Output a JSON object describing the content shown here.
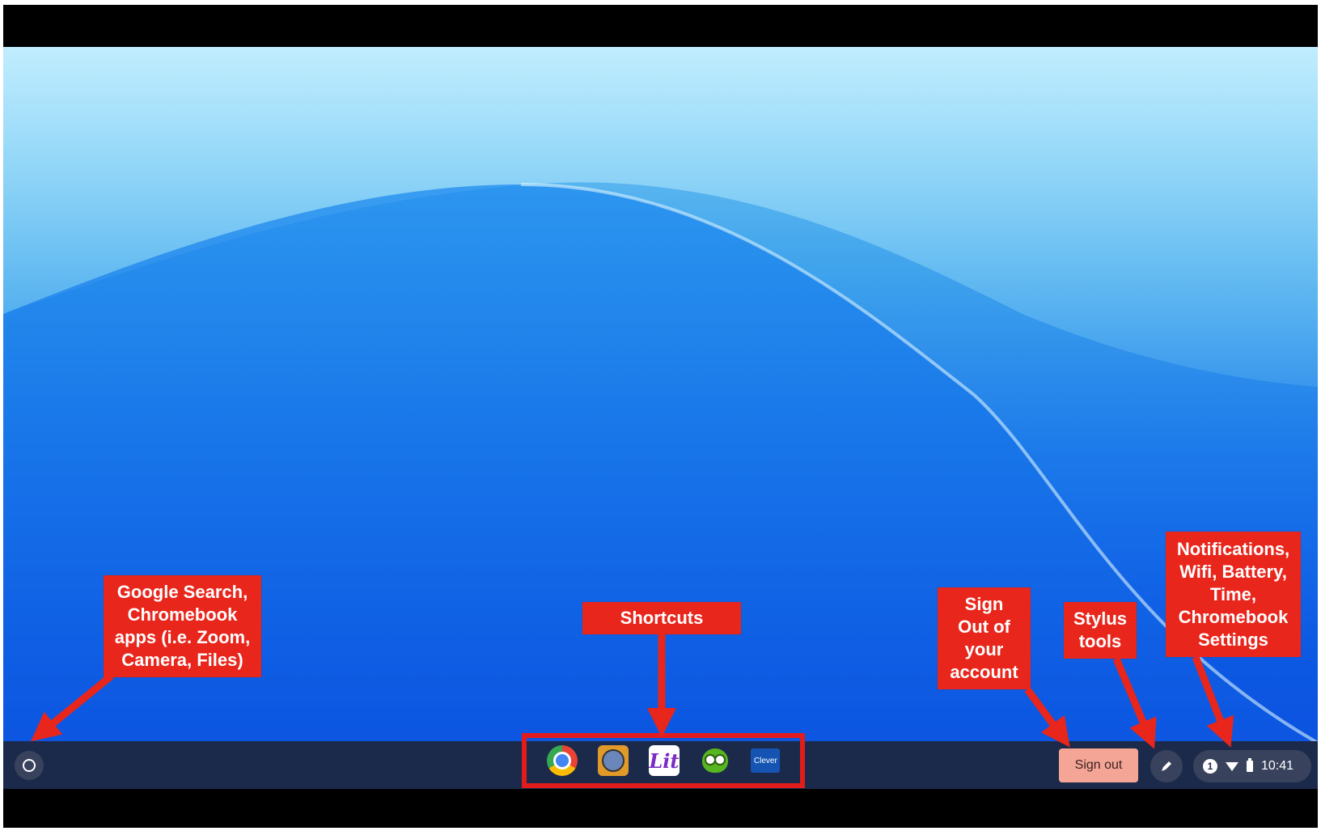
{
  "shelf": {
    "apps": [
      {
        "name": "Google Chrome"
      },
      {
        "name": "Owl app"
      },
      {
        "name": "Lit app",
        "label": "Lit"
      },
      {
        "name": "Duolingo"
      },
      {
        "name": "Clever",
        "label": "Clever"
      }
    ],
    "sign_out_label": "Sign out",
    "tray": {
      "notification_count": "1",
      "time": "10:41"
    }
  },
  "annotations": {
    "launcher": [
      "Google Search,",
      "Chromebook",
      "apps (i.e. Zoom,",
      "Camera, Files)"
    ],
    "shortcuts": [
      "Shortcuts"
    ],
    "sign_out": [
      "Sign",
      "Out of",
      "your",
      "account"
    ],
    "stylus": [
      "Stylus",
      "tools"
    ],
    "tray": [
      "Notifications,",
      "Wifi, Battery,",
      "Time,",
      "Chromebook",
      "Settings"
    ]
  },
  "colors": {
    "annotation_red": "#e8261c",
    "shelf_bg": "#1b2a4b",
    "sign_out_bg": "#f4a596"
  }
}
